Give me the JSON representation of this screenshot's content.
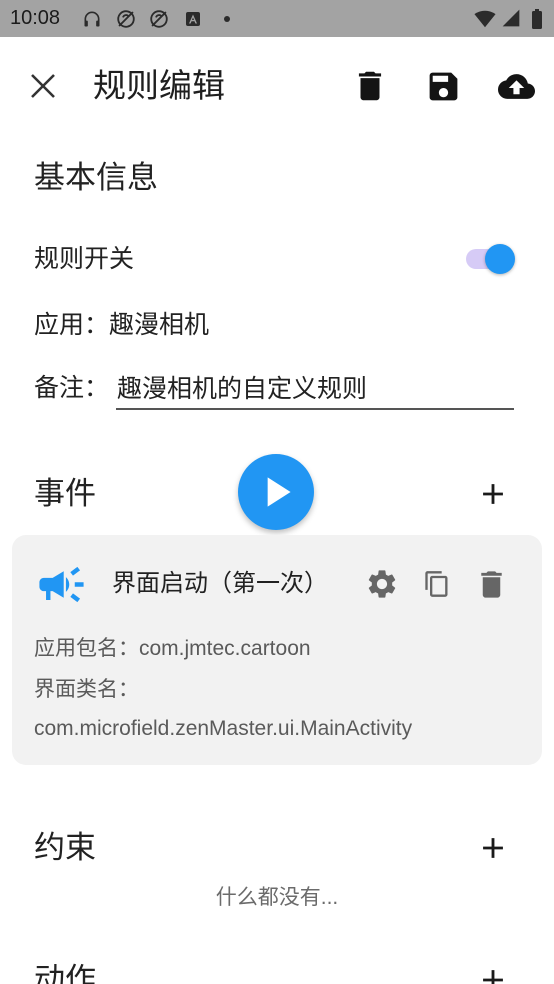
{
  "status_bar": {
    "time": "10:08",
    "notification_icons": [
      "headphones-icon",
      "sync-off-icon",
      "sync-off-icon",
      "a-badge-icon",
      "notification-dot-icon"
    ],
    "system_icons": [
      "wifi-icon",
      "signal-icon",
      "battery-icon"
    ]
  },
  "app_bar": {
    "title": "规则编辑",
    "close_icon": "close-icon",
    "action_icons": [
      "delete-icon",
      "save-icon",
      "cloud-upload-icon"
    ]
  },
  "basic_info": {
    "heading": "基本信息",
    "rule_switch_label": "规则开关",
    "rule_switch_on": true,
    "app_label": "应用：",
    "app_name": "趣漫相机",
    "note_label": "备注：",
    "note_value": "趣漫相机的自定义规则"
  },
  "events": {
    "heading": "事件",
    "add_icon": "add-icon",
    "run_icon": "play-icon",
    "items": [
      {
        "icon": "megaphone-icon",
        "title": "界面启动（第一次）",
        "package_label": "应用包名：",
        "package_value": "com.jmtec.cartoon",
        "activity_label": "界面类名：",
        "activity_value": "com.microfield.zenMaster.ui.MainActivity",
        "action_icons": [
          "settings-icon",
          "copy-icon",
          "delete-icon"
        ]
      }
    ]
  },
  "constraints": {
    "heading": "约束",
    "add_icon": "add-icon",
    "empty_text": "什么都没有..."
  },
  "actions": {
    "heading": "动作",
    "add_icon": "add-icon"
  },
  "colors": {
    "accent": "#2196F3",
    "switch_track": "#D6CBF6",
    "card_background": "#F2F2F2",
    "status_bar_background": "#A3A3A3"
  }
}
